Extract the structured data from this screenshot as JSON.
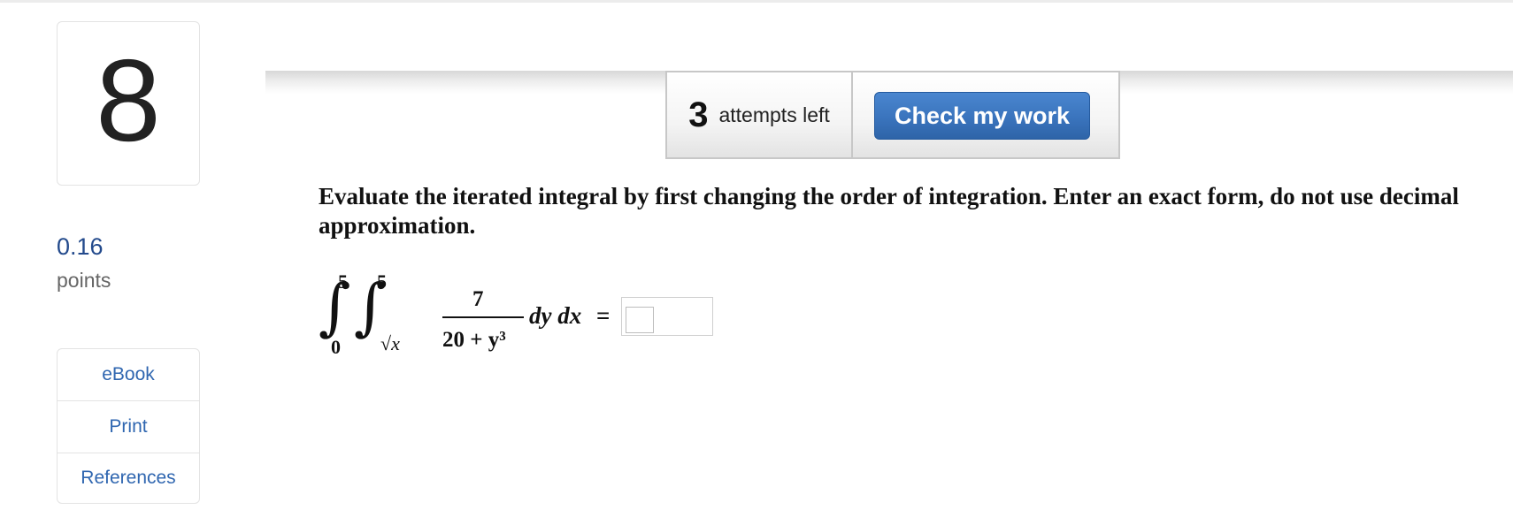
{
  "question": {
    "number": "8",
    "points_value": "0.16",
    "points_label": "points",
    "prompt": "Evaluate the iterated integral by first changing the order of integration. Enter an exact form, do not use decimal approximation."
  },
  "tools": {
    "items": [
      "eBook",
      "Print",
      "References"
    ]
  },
  "attempts": {
    "count": "3",
    "label": "attempts left"
  },
  "check_button": {
    "label": "Check my work"
  },
  "integral": {
    "outer_sign": "∫",
    "outer_lower": "0",
    "outer_upper": "5",
    "inner_sign": "∫",
    "inner_lower": "√x",
    "inner_upper": "5",
    "numerator": "7",
    "denominator": "20 + y³",
    "differentials": "dy dx",
    "equals": "="
  },
  "answer": {
    "value": ""
  },
  "colors": {
    "button_blue": "#3a74bd",
    "link_blue": "#2f66b0",
    "points_blue": "#234a8c"
  }
}
